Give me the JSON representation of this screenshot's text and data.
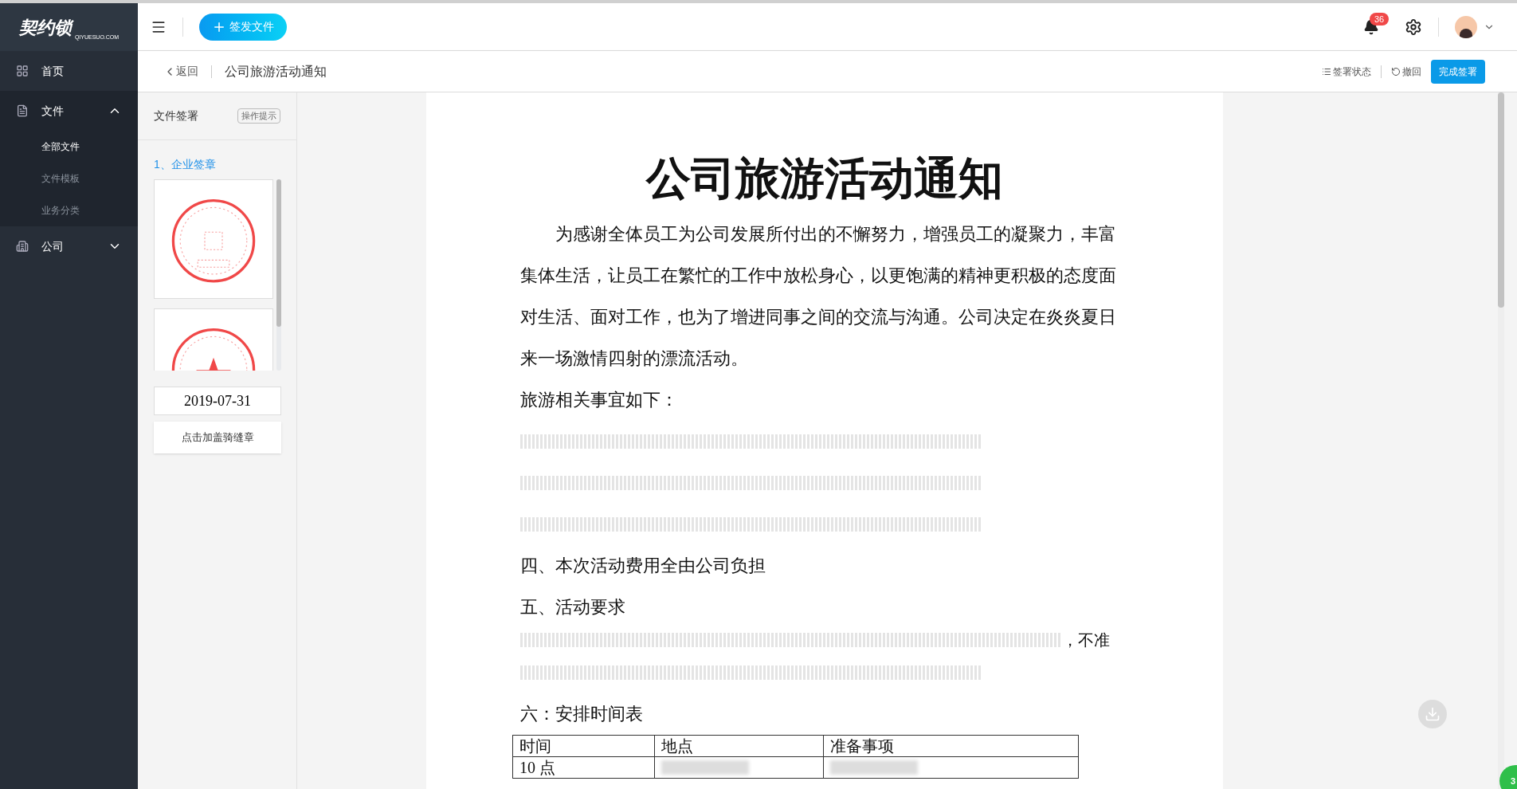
{
  "brand": {
    "name": "契约锁",
    "domain": "QIYUESUO.COM"
  },
  "topbar": {
    "new_button": "签发文件",
    "notifications": "36"
  },
  "sidebar": {
    "items": [
      {
        "label": "首页",
        "kind": "home"
      },
      {
        "label": "文件",
        "kind": "file",
        "expanded": true,
        "children": [
          {
            "label": "全部文件",
            "selected": true
          },
          {
            "label": "文件模板",
            "selected": false
          },
          {
            "label": "业务分类",
            "selected": false
          }
        ]
      },
      {
        "label": "公司",
        "kind": "company",
        "expanded": false
      }
    ]
  },
  "subheader": {
    "back": "返回",
    "title": "公司旅游活动通知",
    "actions": [
      {
        "label": "签署状态",
        "kind": "list"
      },
      {
        "label": "撤回",
        "kind": "undo"
      },
      {
        "label": "完成签署",
        "kind": "primary"
      }
    ]
  },
  "sign_panel": {
    "title": "文件签署",
    "hint": "操作提示",
    "section": "1、企业签章",
    "date": "2019-07-31",
    "seam_button": "点击加盖骑缝章"
  },
  "document": {
    "title": "公司旅游活动通知",
    "blocks": [
      {
        "kind": "para",
        "text": "为感谢全体员工为公司发展所付出的不懈努力，增强员工的凝聚力，丰富集体生活，让员工在繁忙的工作中放松身心，以更饱满的精神更积极的态度面对生活、面对工作，也为了增进同事之间的交流与沟通。公司决定在炎炎夏日来一场激情四射的漂流活动。"
      },
      {
        "kind": "line",
        "text": "旅游相关事宜如下："
      },
      {
        "kind": "faded"
      },
      {
        "kind": "faded"
      },
      {
        "kind": "faded"
      },
      {
        "kind": "line",
        "text": "四、本次活动费用全由公司负担"
      },
      {
        "kind": "line",
        "text": "五、活动要求"
      },
      {
        "kind": "faded_tail",
        "text": "，不准"
      },
      {
        "kind": "faded"
      },
      {
        "kind": "line",
        "text": "六：安排时间表"
      }
    ],
    "table": {
      "columns": [
        "时间",
        "地点",
        "准备事项"
      ],
      "rows": [
        [
          "10 点",
          null,
          null
        ]
      ]
    }
  },
  "overlay_badge": "3"
}
